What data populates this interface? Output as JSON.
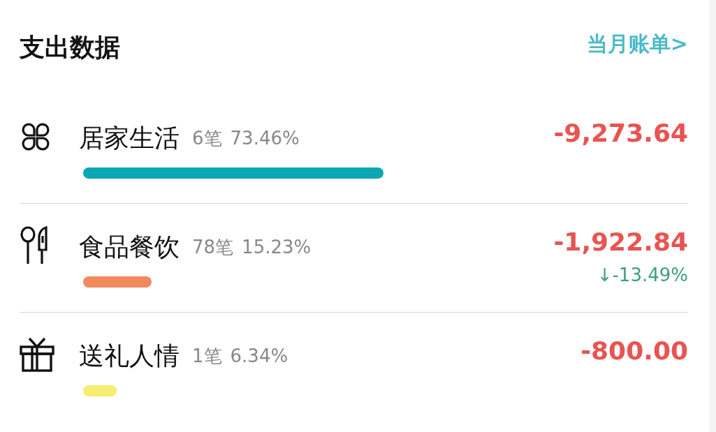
{
  "title": "支出数据",
  "link": "当月账单>",
  "categories": [
    {
      "kind": "clover",
      "name": "居家生活",
      "count": "6笔",
      "percent": "73.46%",
      "amount": "-9,273.64",
      "color": "#0aa8b4"
    },
    {
      "kind": "cutlery",
      "name": "食品餐饮",
      "count": "78笔",
      "percent": "15.23%",
      "amount": "-1,922.84",
      "change": "↓-13.49%",
      "color": "#f08a5d"
    },
    {
      "kind": "gift",
      "name": "送礼人情",
      "count": "1笔",
      "percent": "6.34%",
      "amount": "-800.00",
      "color": "#f6ee70"
    }
  ]
}
